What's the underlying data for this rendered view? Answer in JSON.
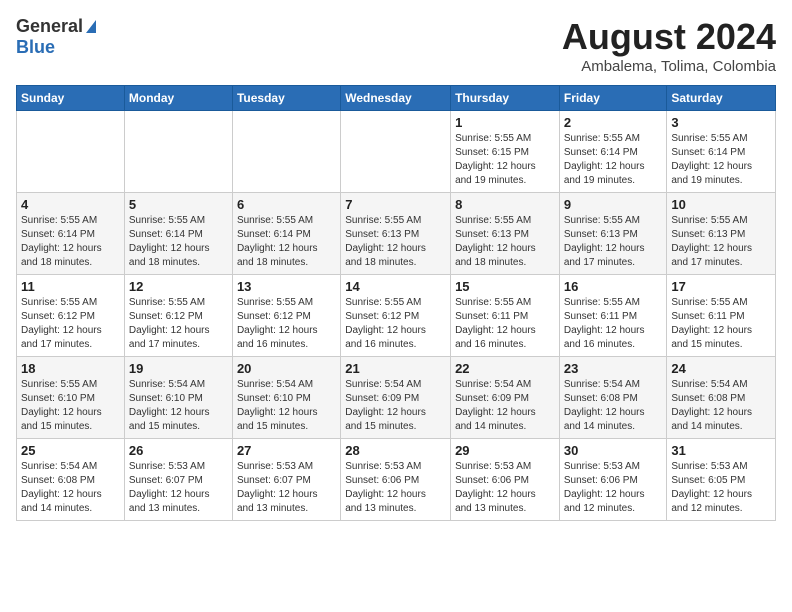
{
  "header": {
    "logo_general": "General",
    "logo_blue": "Blue",
    "month_title": "August 2024",
    "subtitle": "Ambalema, Tolima, Colombia"
  },
  "weekdays": [
    "Sunday",
    "Monday",
    "Tuesday",
    "Wednesday",
    "Thursday",
    "Friday",
    "Saturday"
  ],
  "weeks": [
    [
      {
        "day": "",
        "info": ""
      },
      {
        "day": "",
        "info": ""
      },
      {
        "day": "",
        "info": ""
      },
      {
        "day": "",
        "info": ""
      },
      {
        "day": "1",
        "info": "Sunrise: 5:55 AM\nSunset: 6:15 PM\nDaylight: 12 hours\nand 19 minutes."
      },
      {
        "day": "2",
        "info": "Sunrise: 5:55 AM\nSunset: 6:14 PM\nDaylight: 12 hours\nand 19 minutes."
      },
      {
        "day": "3",
        "info": "Sunrise: 5:55 AM\nSunset: 6:14 PM\nDaylight: 12 hours\nand 19 minutes."
      }
    ],
    [
      {
        "day": "4",
        "info": "Sunrise: 5:55 AM\nSunset: 6:14 PM\nDaylight: 12 hours\nand 18 minutes."
      },
      {
        "day": "5",
        "info": "Sunrise: 5:55 AM\nSunset: 6:14 PM\nDaylight: 12 hours\nand 18 minutes."
      },
      {
        "day": "6",
        "info": "Sunrise: 5:55 AM\nSunset: 6:14 PM\nDaylight: 12 hours\nand 18 minutes."
      },
      {
        "day": "7",
        "info": "Sunrise: 5:55 AM\nSunset: 6:13 PM\nDaylight: 12 hours\nand 18 minutes."
      },
      {
        "day": "8",
        "info": "Sunrise: 5:55 AM\nSunset: 6:13 PM\nDaylight: 12 hours\nand 18 minutes."
      },
      {
        "day": "9",
        "info": "Sunrise: 5:55 AM\nSunset: 6:13 PM\nDaylight: 12 hours\nand 17 minutes."
      },
      {
        "day": "10",
        "info": "Sunrise: 5:55 AM\nSunset: 6:13 PM\nDaylight: 12 hours\nand 17 minutes."
      }
    ],
    [
      {
        "day": "11",
        "info": "Sunrise: 5:55 AM\nSunset: 6:12 PM\nDaylight: 12 hours\nand 17 minutes."
      },
      {
        "day": "12",
        "info": "Sunrise: 5:55 AM\nSunset: 6:12 PM\nDaylight: 12 hours\nand 17 minutes."
      },
      {
        "day": "13",
        "info": "Sunrise: 5:55 AM\nSunset: 6:12 PM\nDaylight: 12 hours\nand 16 minutes."
      },
      {
        "day": "14",
        "info": "Sunrise: 5:55 AM\nSunset: 6:12 PM\nDaylight: 12 hours\nand 16 minutes."
      },
      {
        "day": "15",
        "info": "Sunrise: 5:55 AM\nSunset: 6:11 PM\nDaylight: 12 hours\nand 16 minutes."
      },
      {
        "day": "16",
        "info": "Sunrise: 5:55 AM\nSunset: 6:11 PM\nDaylight: 12 hours\nand 16 minutes."
      },
      {
        "day": "17",
        "info": "Sunrise: 5:55 AM\nSunset: 6:11 PM\nDaylight: 12 hours\nand 15 minutes."
      }
    ],
    [
      {
        "day": "18",
        "info": "Sunrise: 5:55 AM\nSunset: 6:10 PM\nDaylight: 12 hours\nand 15 minutes."
      },
      {
        "day": "19",
        "info": "Sunrise: 5:54 AM\nSunset: 6:10 PM\nDaylight: 12 hours\nand 15 minutes."
      },
      {
        "day": "20",
        "info": "Sunrise: 5:54 AM\nSunset: 6:10 PM\nDaylight: 12 hours\nand 15 minutes."
      },
      {
        "day": "21",
        "info": "Sunrise: 5:54 AM\nSunset: 6:09 PM\nDaylight: 12 hours\nand 15 minutes."
      },
      {
        "day": "22",
        "info": "Sunrise: 5:54 AM\nSunset: 6:09 PM\nDaylight: 12 hours\nand 14 minutes."
      },
      {
        "day": "23",
        "info": "Sunrise: 5:54 AM\nSunset: 6:08 PM\nDaylight: 12 hours\nand 14 minutes."
      },
      {
        "day": "24",
        "info": "Sunrise: 5:54 AM\nSunset: 6:08 PM\nDaylight: 12 hours\nand 14 minutes."
      }
    ],
    [
      {
        "day": "25",
        "info": "Sunrise: 5:54 AM\nSunset: 6:08 PM\nDaylight: 12 hours\nand 14 minutes."
      },
      {
        "day": "26",
        "info": "Sunrise: 5:53 AM\nSunset: 6:07 PM\nDaylight: 12 hours\nand 13 minutes."
      },
      {
        "day": "27",
        "info": "Sunrise: 5:53 AM\nSunset: 6:07 PM\nDaylight: 12 hours\nand 13 minutes."
      },
      {
        "day": "28",
        "info": "Sunrise: 5:53 AM\nSunset: 6:06 PM\nDaylight: 12 hours\nand 13 minutes."
      },
      {
        "day": "29",
        "info": "Sunrise: 5:53 AM\nSunset: 6:06 PM\nDaylight: 12 hours\nand 13 minutes."
      },
      {
        "day": "30",
        "info": "Sunrise: 5:53 AM\nSunset: 6:06 PM\nDaylight: 12 hours\nand 12 minutes."
      },
      {
        "day": "31",
        "info": "Sunrise: 5:53 AM\nSunset: 6:05 PM\nDaylight: 12 hours\nand 12 minutes."
      }
    ]
  ]
}
